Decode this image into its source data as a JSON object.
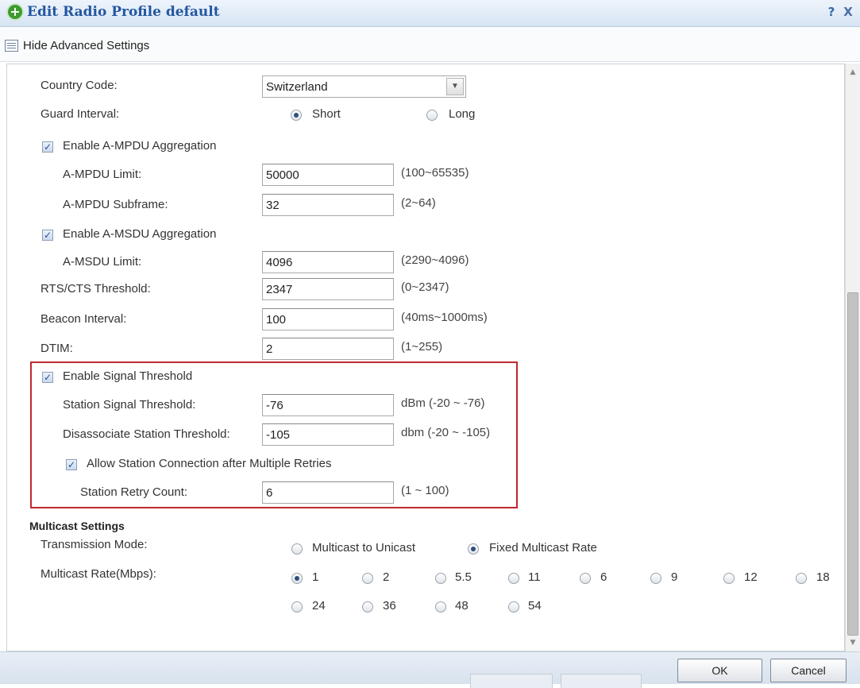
{
  "window": {
    "title": "Edit Radio Profile default",
    "help_label": "?",
    "close_label": "X"
  },
  "toolbar": {
    "advanced_toggle_label": "Hide Advanced Settings"
  },
  "form": {
    "country_code": {
      "label": "Country Code:",
      "value": "Switzerland"
    },
    "guard_interval": {
      "label": "Guard Interval:",
      "options": [
        "Short",
        "Long"
      ],
      "selected": "Short"
    },
    "ampdu": {
      "enable_label": "Enable A-MPDU Aggregation",
      "enabled": true,
      "limit": {
        "label": "A-MPDU Limit:",
        "value": "50000",
        "hint": "(100~65535)"
      },
      "subframe": {
        "label": "A-MPDU Subframe:",
        "value": "32",
        "hint": "(2~64)"
      }
    },
    "amsdu": {
      "enable_label": "Enable A-MSDU Aggregation",
      "enabled": true,
      "limit": {
        "label": "A-MSDU Limit:",
        "value": "4096",
        "hint": "(2290~4096)"
      }
    },
    "rts_cts": {
      "label": "RTS/CTS Threshold:",
      "value": "2347",
      "hint": "(0~2347)"
    },
    "beacon": {
      "label": "Beacon Interval:",
      "value": "100",
      "hint": "(40ms~1000ms)"
    },
    "dtim": {
      "label": "DTIM:",
      "value": "2",
      "hint": "(1~255)"
    },
    "signal_threshold": {
      "enable_label": "Enable Signal Threshold",
      "enabled": true,
      "station_signal": {
        "label": "Station Signal Threshold:",
        "value": "-76",
        "hint": "dBm (-20 ~ -76)"
      },
      "disassociate": {
        "label": "Disassociate Station Threshold:",
        "value": "-105",
        "hint": "dbm (-20 ~ -105)"
      },
      "allow_retries": {
        "label": "Allow Station Connection after Multiple Retries",
        "enabled": true
      },
      "retry_count": {
        "label": "Station Retry Count:",
        "value": "6",
        "hint": "(1 ~ 100)"
      }
    }
  },
  "multicast": {
    "section_title": "Multicast Settings",
    "transmission_mode": {
      "label": "Transmission Mode:",
      "options": [
        "Multicast to Unicast",
        "Fixed Multicast Rate"
      ],
      "selected": "Fixed Multicast Rate"
    },
    "rate": {
      "label": "Multicast Rate(Mbps):",
      "options": [
        "1",
        "2",
        "5.5",
        "11",
        "6",
        "9",
        "12",
        "18",
        "24",
        "36",
        "48",
        "54"
      ],
      "selected": "1"
    }
  },
  "buttons": {
    "ok": "OK",
    "cancel": "Cancel"
  },
  "colors": {
    "title_text": "#2457a0",
    "highlight_border": "#c0282f",
    "title_bar": "#d6e4f3"
  }
}
